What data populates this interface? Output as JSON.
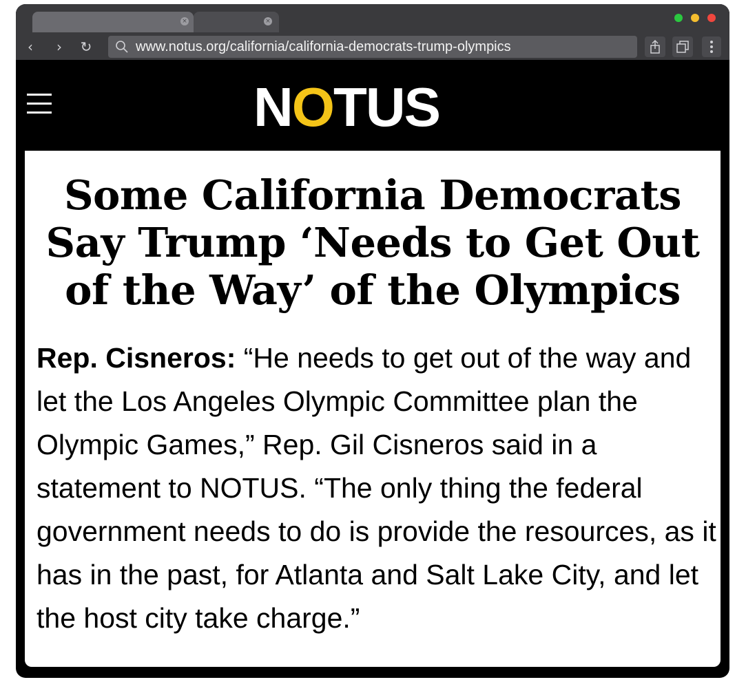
{
  "browser": {
    "tabs": [
      {
        "close_glyph": "×"
      },
      {
        "close_glyph": "×"
      }
    ],
    "window_controls": {
      "colors": [
        "#2bc840",
        "#f5be2f",
        "#f0473e"
      ]
    },
    "nav": {
      "back": "‹",
      "forward": "›",
      "reload": "↻"
    },
    "url": "www.notus.org/california/california-democrats-trump-olympics",
    "icons": [
      "search-icon",
      "share-icon",
      "tabs-icon",
      "more-icon"
    ]
  },
  "site": {
    "logo_prefix": "N",
    "logo_o": "O",
    "logo_suffix": "TUS",
    "accent_color": "#f4c418",
    "menu_icon": "hamburger-menu-icon"
  },
  "article": {
    "headline": "Some California Democrats Say Trump ‘Needs to Get Out of the Way’ of the Olympics",
    "speaker": "Rep. Cisneros:",
    "body": " “He needs to get out of the way and let the Los Angeles Olympic Committee plan the Olympic Games,” Rep. Gil Cisneros said in a statement to NOTUS. “The only thing the federal government needs to do is provide the resources, as it has in the past, for Atlanta and Salt Lake City, and let the host city take charge.”"
  }
}
